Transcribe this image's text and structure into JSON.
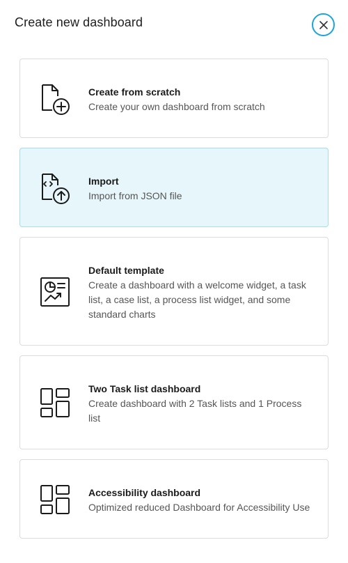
{
  "dialog": {
    "title": "Create new dashboard",
    "close_icon": "close-icon",
    "accent_color": "#1ba4d6",
    "selected_background": "#e6f6fa"
  },
  "options": [
    {
      "id": "scratch",
      "icon": "file-add-icon",
      "title": "Create from scratch",
      "description": "Create your own dashboard from scratch",
      "selected": false
    },
    {
      "id": "import",
      "icon": "file-code-upload-icon",
      "title": "Import",
      "description": "Import from JSON file",
      "selected": true
    },
    {
      "id": "default-template",
      "icon": "report-chart-icon",
      "title": "Default template",
      "description": "Create a dashboard with a welcome widget, a task list, a case list, a process list widget, and some standard charts",
      "selected": false
    },
    {
      "id": "two-task-list",
      "icon": "layout-grid-icon",
      "title": "Two Task list dashboard",
      "description": "Create dashboard with 2 Task lists and 1 Process list",
      "selected": false
    },
    {
      "id": "accessibility",
      "icon": "layout-grid-icon",
      "title": "Accessibility dashboard",
      "description": "Optimized reduced Dashboard for Accessibility Use",
      "selected": false
    }
  ]
}
